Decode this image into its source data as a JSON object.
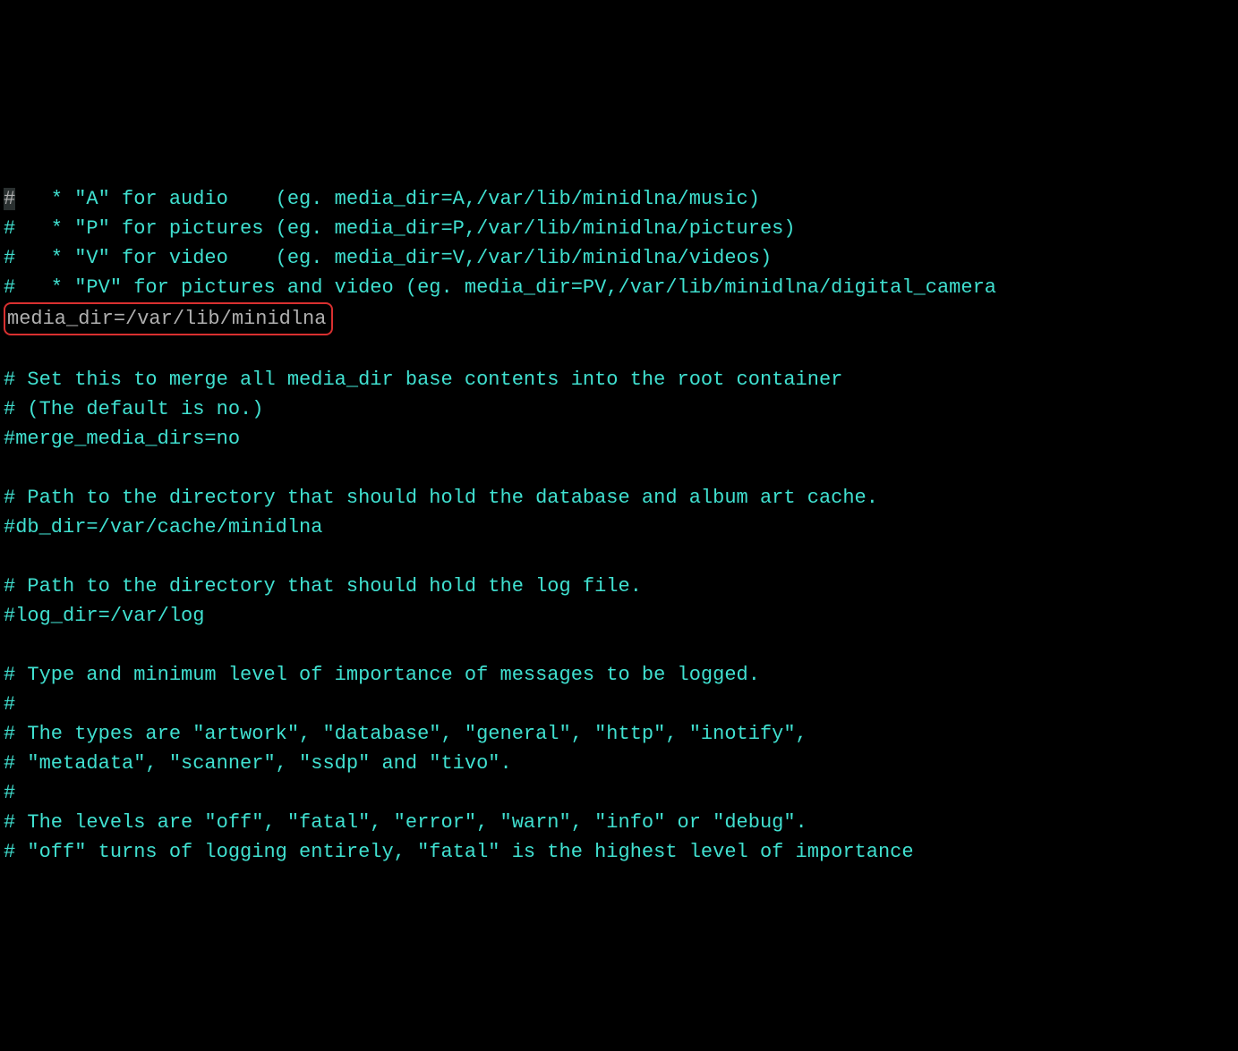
{
  "terminal": {
    "lines": [
      "#   * \"A\" for audio    (eg. media_dir=A,/var/lib/minidlna/music)",
      "#   * \"P\" for pictures (eg. media_dir=P,/var/lib/minidlna/pictures)",
      "#   * \"V\" for video    (eg. media_dir=V,/var/lib/minidlna/videos)",
      "#   * \"PV\" for pictures and video (eg. media_dir=PV,/var/lib/minidlna/digital_camera",
      "media_dir=/var/lib/minidlna",
      "",
      "# Set this to merge all media_dir base contents into the root container",
      "# (The default is no.)",
      "#merge_media_dirs=no",
      "",
      "# Path to the directory that should hold the database and album art cache.",
      "#db_dir=/var/cache/minidlna",
      "",
      "# Path to the directory that should hold the log file.",
      "#log_dir=/var/log",
      "",
      "# Type and minimum level of importance of messages to be logged.",
      "#",
      "# The types are \"artwork\", \"database\", \"general\", \"http\", \"inotify\",",
      "# \"metadata\", \"scanner\", \"ssdp\" and \"tivo\".",
      "#",
      "# The levels are \"off\", \"fatal\", \"error\", \"warn\", \"info\" or \"debug\".",
      "# \"off\" turns of logging entirely, \"fatal\" is the highest level of importance"
    ],
    "highlighted_line_index": 4,
    "cursor_line_index": 0
  }
}
